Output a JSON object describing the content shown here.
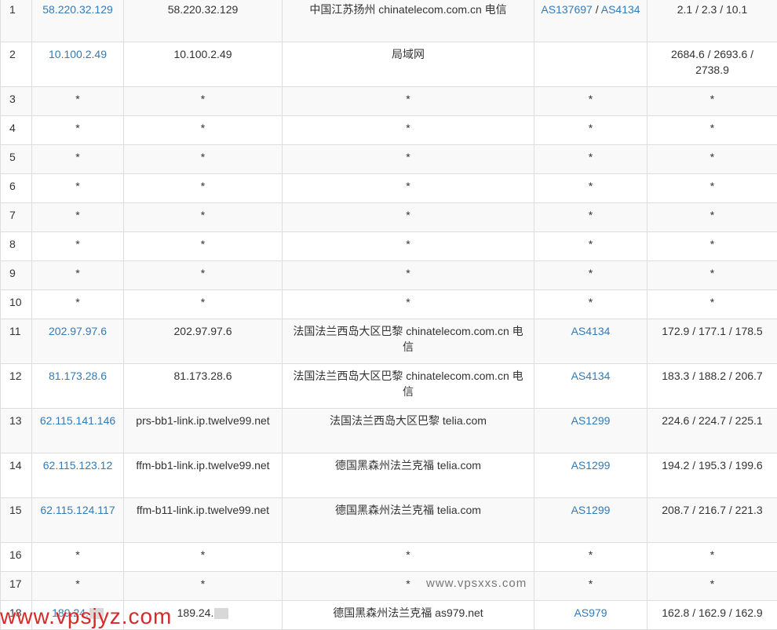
{
  "rows": [
    {
      "hop": "1",
      "ip": "58.220.32.129",
      "host": "58.220.32.129",
      "loc": "中国江苏扬州 chinatelecom.com.cn 电信",
      "asn": [
        "AS137697",
        "AS4134"
      ],
      "lat": "2.1 / 2.3 / 10.1"
    },
    {
      "hop": "2",
      "ip": "10.100.2.49",
      "host": "10.100.2.49",
      "loc": "局域网",
      "asn": [],
      "lat": "2684.6 / 2693.6 / 2738.9"
    },
    {
      "hop": "3",
      "ip": "*",
      "host": "*",
      "loc": "*",
      "asn": [
        "*"
      ],
      "lat": "*"
    },
    {
      "hop": "4",
      "ip": "*",
      "host": "*",
      "loc": "*",
      "asn": [
        "*"
      ],
      "lat": "*"
    },
    {
      "hop": "5",
      "ip": "*",
      "host": "*",
      "loc": "*",
      "asn": [
        "*"
      ],
      "lat": "*"
    },
    {
      "hop": "6",
      "ip": "*",
      "host": "*",
      "loc": "*",
      "asn": [
        "*"
      ],
      "lat": "*"
    },
    {
      "hop": "7",
      "ip": "*",
      "host": "*",
      "loc": "*",
      "asn": [
        "*"
      ],
      "lat": "*"
    },
    {
      "hop": "8",
      "ip": "*",
      "host": "*",
      "loc": "*",
      "asn": [
        "*"
      ],
      "lat": "*"
    },
    {
      "hop": "9",
      "ip": "*",
      "host": "*",
      "loc": "*",
      "asn": [
        "*"
      ],
      "lat": "*"
    },
    {
      "hop": "10",
      "ip": "*",
      "host": "*",
      "loc": "*",
      "asn": [
        "*"
      ],
      "lat": "*"
    },
    {
      "hop": "11",
      "ip": "202.97.97.6",
      "host": "202.97.97.6",
      "loc": "法国法兰西岛大区巴黎 chinatelecom.com.cn 电信",
      "asn": [
        "AS4134"
      ],
      "lat": "172.9 / 177.1 / 178.5"
    },
    {
      "hop": "12",
      "ip": "81.173.28.6",
      "host": "81.173.28.6",
      "loc": "法国法兰西岛大区巴黎 chinatelecom.com.cn 电信",
      "asn": [
        "AS4134"
      ],
      "lat": "183.3 / 188.2 / 206.7"
    },
    {
      "hop": "13",
      "ip": "62.115.141.146",
      "host": "prs-bb1-link.ip.twelve99.net",
      "loc": "法国法兰西岛大区巴黎 telia.com",
      "asn": [
        "AS1299"
      ],
      "lat": "224.6 / 224.7 / 225.1"
    },
    {
      "hop": "14",
      "ip": "62.115.123.12",
      "host": "ffm-bb1-link.ip.twelve99.net",
      "loc": "德国黑森州法兰克福 telia.com",
      "asn": [
        "AS1299"
      ],
      "lat": "194.2 / 195.3 / 199.6"
    },
    {
      "hop": "15",
      "ip": "62.115.124.117",
      "host": "ffm-b11-link.ip.twelve99.net",
      "loc": "德国黑森州法兰克福 telia.com",
      "asn": [
        "AS1299"
      ],
      "lat": "208.7 / 216.7 / 221.3"
    },
    {
      "hop": "16",
      "ip": "*",
      "host": "*",
      "loc": "*",
      "asn": [
        "*"
      ],
      "lat": "*"
    },
    {
      "hop": "17",
      "ip": "*",
      "host": "*",
      "loc": "*",
      "asn": [
        "*"
      ],
      "lat": "*"
    },
    {
      "hop": "18",
      "ip": "189.24.",
      "host": "189.24.",
      "loc": "德国黑森州法兰克福 as979.net",
      "asn": [
        "AS979"
      ],
      "lat": "162.8 / 162.9 / 162.9"
    }
  ],
  "watermarks": {
    "center": "www.vpsxxs.com",
    "corner": "www.vpsjyz.com"
  },
  "colors": {
    "link": "#337ab7",
    "border": "#dddddd",
    "stripe": "#f9f9f9",
    "watermark_red": "#d62a2a"
  }
}
